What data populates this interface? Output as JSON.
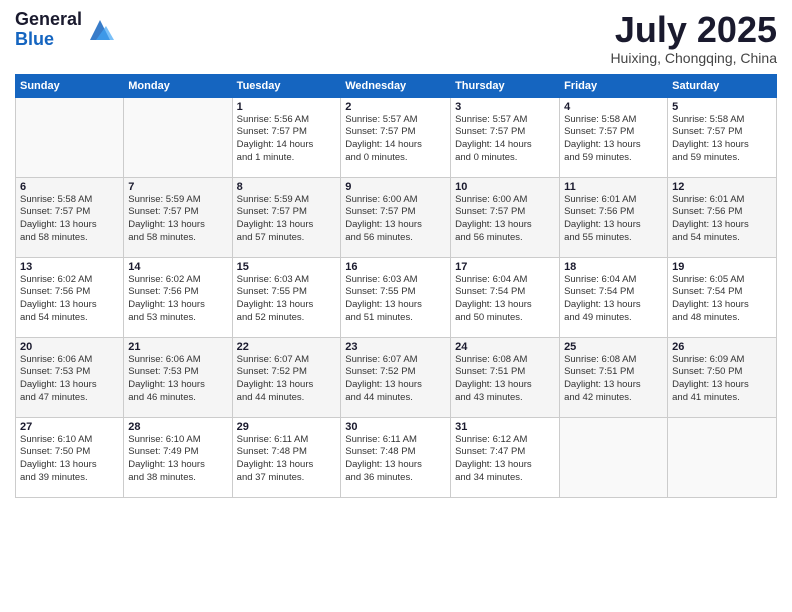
{
  "logo": {
    "general": "General",
    "blue": "Blue"
  },
  "title": "July 2025",
  "location": "Huixing, Chongqing, China",
  "header_days": [
    "Sunday",
    "Monday",
    "Tuesday",
    "Wednesday",
    "Thursday",
    "Friday",
    "Saturday"
  ],
  "weeks": [
    [
      {
        "day": "",
        "info": ""
      },
      {
        "day": "",
        "info": ""
      },
      {
        "day": "1",
        "info": "Sunrise: 5:56 AM\nSunset: 7:57 PM\nDaylight: 14 hours\nand 1 minute."
      },
      {
        "day": "2",
        "info": "Sunrise: 5:57 AM\nSunset: 7:57 PM\nDaylight: 14 hours\nand 0 minutes."
      },
      {
        "day": "3",
        "info": "Sunrise: 5:57 AM\nSunset: 7:57 PM\nDaylight: 14 hours\nand 0 minutes."
      },
      {
        "day": "4",
        "info": "Sunrise: 5:58 AM\nSunset: 7:57 PM\nDaylight: 13 hours\nand 59 minutes."
      },
      {
        "day": "5",
        "info": "Sunrise: 5:58 AM\nSunset: 7:57 PM\nDaylight: 13 hours\nand 59 minutes."
      }
    ],
    [
      {
        "day": "6",
        "info": "Sunrise: 5:58 AM\nSunset: 7:57 PM\nDaylight: 13 hours\nand 58 minutes."
      },
      {
        "day": "7",
        "info": "Sunrise: 5:59 AM\nSunset: 7:57 PM\nDaylight: 13 hours\nand 58 minutes."
      },
      {
        "day": "8",
        "info": "Sunrise: 5:59 AM\nSunset: 7:57 PM\nDaylight: 13 hours\nand 57 minutes."
      },
      {
        "day": "9",
        "info": "Sunrise: 6:00 AM\nSunset: 7:57 PM\nDaylight: 13 hours\nand 56 minutes."
      },
      {
        "day": "10",
        "info": "Sunrise: 6:00 AM\nSunset: 7:57 PM\nDaylight: 13 hours\nand 56 minutes."
      },
      {
        "day": "11",
        "info": "Sunrise: 6:01 AM\nSunset: 7:56 PM\nDaylight: 13 hours\nand 55 minutes."
      },
      {
        "day": "12",
        "info": "Sunrise: 6:01 AM\nSunset: 7:56 PM\nDaylight: 13 hours\nand 54 minutes."
      }
    ],
    [
      {
        "day": "13",
        "info": "Sunrise: 6:02 AM\nSunset: 7:56 PM\nDaylight: 13 hours\nand 54 minutes."
      },
      {
        "day": "14",
        "info": "Sunrise: 6:02 AM\nSunset: 7:56 PM\nDaylight: 13 hours\nand 53 minutes."
      },
      {
        "day": "15",
        "info": "Sunrise: 6:03 AM\nSunset: 7:55 PM\nDaylight: 13 hours\nand 52 minutes."
      },
      {
        "day": "16",
        "info": "Sunrise: 6:03 AM\nSunset: 7:55 PM\nDaylight: 13 hours\nand 51 minutes."
      },
      {
        "day": "17",
        "info": "Sunrise: 6:04 AM\nSunset: 7:54 PM\nDaylight: 13 hours\nand 50 minutes."
      },
      {
        "day": "18",
        "info": "Sunrise: 6:04 AM\nSunset: 7:54 PM\nDaylight: 13 hours\nand 49 minutes."
      },
      {
        "day": "19",
        "info": "Sunrise: 6:05 AM\nSunset: 7:54 PM\nDaylight: 13 hours\nand 48 minutes."
      }
    ],
    [
      {
        "day": "20",
        "info": "Sunrise: 6:06 AM\nSunset: 7:53 PM\nDaylight: 13 hours\nand 47 minutes."
      },
      {
        "day": "21",
        "info": "Sunrise: 6:06 AM\nSunset: 7:53 PM\nDaylight: 13 hours\nand 46 minutes."
      },
      {
        "day": "22",
        "info": "Sunrise: 6:07 AM\nSunset: 7:52 PM\nDaylight: 13 hours\nand 44 minutes."
      },
      {
        "day": "23",
        "info": "Sunrise: 6:07 AM\nSunset: 7:52 PM\nDaylight: 13 hours\nand 44 minutes."
      },
      {
        "day": "24",
        "info": "Sunrise: 6:08 AM\nSunset: 7:51 PM\nDaylight: 13 hours\nand 43 minutes."
      },
      {
        "day": "25",
        "info": "Sunrise: 6:08 AM\nSunset: 7:51 PM\nDaylight: 13 hours\nand 42 minutes."
      },
      {
        "day": "26",
        "info": "Sunrise: 6:09 AM\nSunset: 7:50 PM\nDaylight: 13 hours\nand 41 minutes."
      }
    ],
    [
      {
        "day": "27",
        "info": "Sunrise: 6:10 AM\nSunset: 7:50 PM\nDaylight: 13 hours\nand 39 minutes."
      },
      {
        "day": "28",
        "info": "Sunrise: 6:10 AM\nSunset: 7:49 PM\nDaylight: 13 hours\nand 38 minutes."
      },
      {
        "day": "29",
        "info": "Sunrise: 6:11 AM\nSunset: 7:48 PM\nDaylight: 13 hours\nand 37 minutes."
      },
      {
        "day": "30",
        "info": "Sunrise: 6:11 AM\nSunset: 7:48 PM\nDaylight: 13 hours\nand 36 minutes."
      },
      {
        "day": "31",
        "info": "Sunrise: 6:12 AM\nSunset: 7:47 PM\nDaylight: 13 hours\nand 34 minutes."
      },
      {
        "day": "",
        "info": ""
      },
      {
        "day": "",
        "info": ""
      }
    ]
  ]
}
